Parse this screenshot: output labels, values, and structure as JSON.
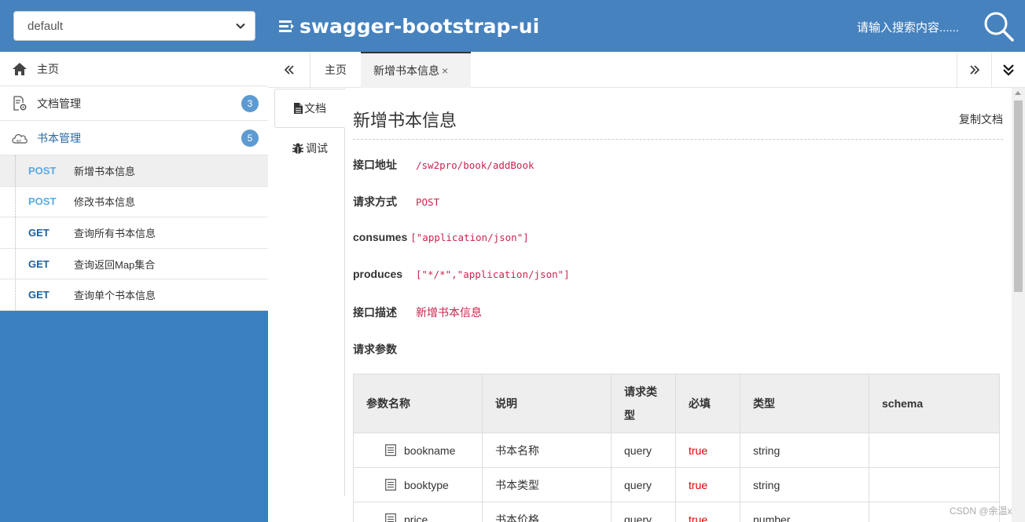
{
  "header": {
    "group_select_value": "default",
    "brand_title": "swagger-bootstrap-ui",
    "search_placeholder": "请输入搜索内容......"
  },
  "sidebar": {
    "menu": [
      {
        "label": "主页",
        "icon": "home-icon"
      },
      {
        "label": "文档管理",
        "icon": "doc-settings-icon",
        "badge": "3"
      },
      {
        "label": "书本管理",
        "icon": "cloud-icon",
        "badge": "5"
      }
    ],
    "apis": [
      {
        "method": "POST",
        "name": "新增书本信息"
      },
      {
        "method": "POST",
        "name": "修改书本信息"
      },
      {
        "method": "GET",
        "name": "查询所有书本信息"
      },
      {
        "method": "GET",
        "name": "查询返回Map集合"
      },
      {
        "method": "GET",
        "name": "查询单个书本信息"
      }
    ]
  },
  "tabs": {
    "home": "主页",
    "active": "新增书本信息",
    "close": "×"
  },
  "vtabs": {
    "doc": "文档",
    "debug": "调试"
  },
  "doc": {
    "title": "新增书本信息",
    "copy_label": "复制文档",
    "fields": {
      "url_label": "接口地址",
      "url_value": "/sw2pro/book/addBook",
      "method_label": "请求方式",
      "method_value": "POST",
      "consumes_label": "consumes",
      "consumes_value": "[\"application/json\"]",
      "produces_label": "produces",
      "produces_value": "[\"*/*\",\"application/json\"]",
      "desc_label": "接口描述",
      "desc_value": "新增书本信息",
      "params_label": "请求参数"
    },
    "table": {
      "headers": {
        "name": "参数名称",
        "desc": "说明",
        "in": "请求类型",
        "required": "必填",
        "type": "类型",
        "schema": "schema"
      },
      "rows": [
        {
          "name": "bookname",
          "desc": "书本名称",
          "in": "query",
          "required": "true",
          "type": "string",
          "schema": ""
        },
        {
          "name": "booktype",
          "desc": "书本类型",
          "in": "query",
          "required": "true",
          "type": "string",
          "schema": ""
        },
        {
          "name": "price",
          "desc": "书本价格",
          "in": "query",
          "required": "true",
          "type": "number",
          "schema": ""
        }
      ]
    }
  },
  "watermark": "CSDN @余温x",
  "colors": {
    "header_bg": "#4682be",
    "sidebar_bg": "#3a7fbf",
    "post_method": "#5aaae2",
    "get_method": "#1c5f9a",
    "badge": "#5c9ad1",
    "code_text": "#c7254e",
    "required_text": "#e10000"
  }
}
